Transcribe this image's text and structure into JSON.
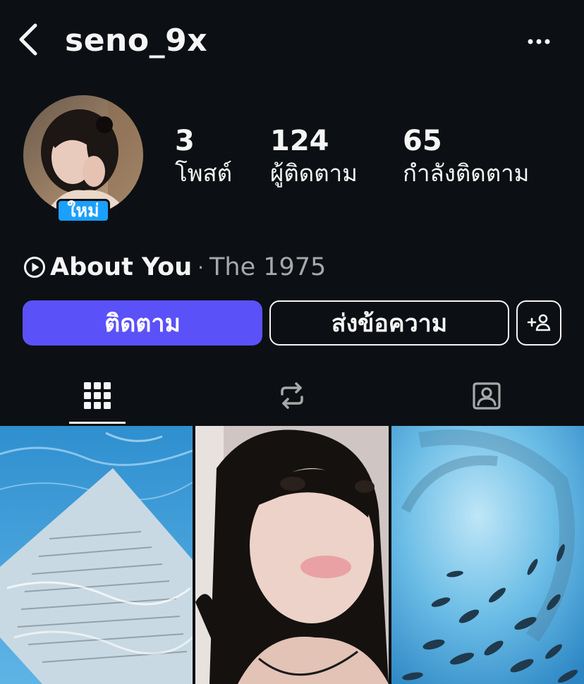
{
  "header": {
    "username": "seno_9x",
    "back_icon": "chevron-left-icon",
    "more_icon": "more-horizontal-icon"
  },
  "profile": {
    "new_badge": "ใหม่",
    "stats": [
      {
        "value": "3",
        "label": "โพสต์"
      },
      {
        "value": "124",
        "label": "ผู้ติดตาม"
      },
      {
        "value": "65",
        "label": "กำลังติดตาม"
      }
    ],
    "music": {
      "icon": "play-circle-icon",
      "song": "About You",
      "separator": "·",
      "artist": "The 1975"
    }
  },
  "actions": {
    "follow_label": "ติดตาม",
    "message_label": "ส่งข้อความ",
    "suggest_icon": "add-person-icon"
  },
  "tabs": [
    {
      "icon": "grid-icon",
      "selected": true
    },
    {
      "icon": "repost-icon",
      "selected": false
    },
    {
      "icon": "tagged-person-icon",
      "selected": false
    }
  ],
  "posts": [
    {
      "subject": "paper in pool water"
    },
    {
      "subject": "girl portrait"
    },
    {
      "subject": "school of fish underwater"
    }
  ],
  "colors": {
    "background": "#0c1014",
    "primary_button": "#5b51f8",
    "badge": "#1aa0ff",
    "secondary_text": "#a8a8a8"
  }
}
